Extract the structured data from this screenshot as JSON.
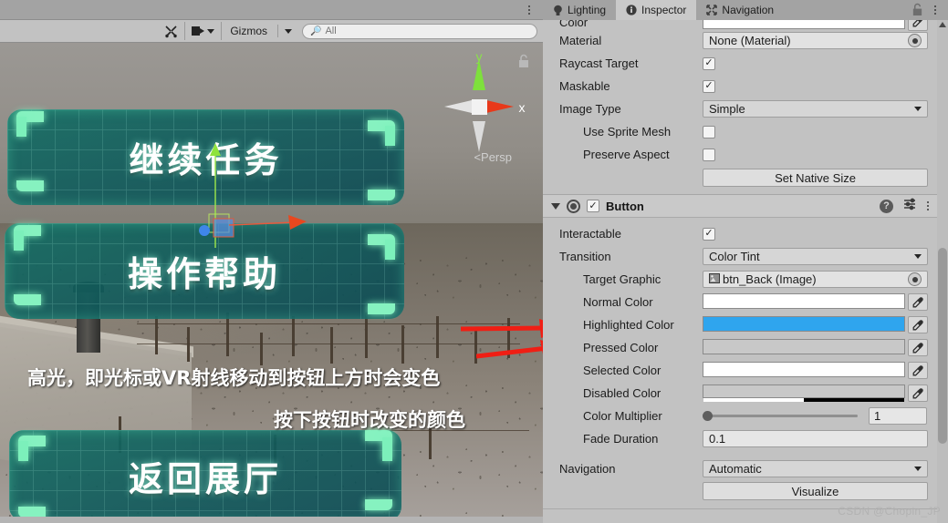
{
  "scene": {
    "toolbar": {
      "tools_icon": "tools-icon",
      "camera_icon": "camera-icon",
      "gizmos_label": "Gizmos",
      "search_placeholder": "All",
      "search_value": ""
    },
    "gizmo": {
      "axis_x": "x",
      "axis_y": "y",
      "projection": "Persp",
      "projection_prefix": "<",
      "lock_icon": "unlock-icon"
    },
    "vr_buttons": [
      {
        "label": "继续任务"
      },
      {
        "label": "操作帮助"
      },
      {
        "label": "返回展厅"
      }
    ],
    "annotations": [
      {
        "text": "高光，即光标或VR射线移动到按钮上方时会变色"
      },
      {
        "text": "按下按钮时改变的颜色"
      }
    ]
  },
  "inspector": {
    "tabs": [
      {
        "label": "Lighting",
        "icon": "lightbulb-icon",
        "active": false
      },
      {
        "label": "Inspector",
        "icon": "info-icon",
        "active": true
      },
      {
        "label": "Navigation",
        "icon": "navigation-icon",
        "active": false
      }
    ],
    "lock_icon": "lock-icon",
    "menu_icon": "kebab-menu-icon",
    "image_component": {
      "rows": [
        {
          "label": "Color",
          "type": "color",
          "value": "#FFFFFF",
          "alpha": 1
        },
        {
          "label": "Material",
          "type": "object",
          "value": "None (Material)"
        },
        {
          "label": "Raycast Target",
          "type": "checkbox",
          "value": true
        },
        {
          "label": "Maskable",
          "type": "checkbox",
          "value": true
        },
        {
          "label": "Image Type",
          "type": "popup",
          "value": "Simple"
        },
        {
          "label": "Use Sprite Mesh",
          "type": "checkbox",
          "value": false,
          "indent": true
        },
        {
          "label": "Preserve Aspect",
          "type": "checkbox",
          "value": false,
          "indent": true
        }
      ],
      "set_native_size_label": "Set Native Size"
    },
    "button_component": {
      "title": "Button",
      "enabled": true,
      "help_icon": "help-icon",
      "preset_icon": "preset-icon",
      "menu_icon": "kebab-menu-icon",
      "interactable_label": "Interactable",
      "interactable_value": true,
      "transition_label": "Transition",
      "transition_value": "Color Tint",
      "target_graphic_label": "Target Graphic",
      "target_graphic_value": "btn_Back (Image)",
      "colors": [
        {
          "label": "Normal Color",
          "value": "#FFFFFF",
          "alpha": 1
        },
        {
          "label": "Highlighted Color",
          "value": "#2FA5EE",
          "alpha": 1
        },
        {
          "label": "Pressed Color",
          "value": "#C8C8C8",
          "alpha": 1
        },
        {
          "label": "Selected Color",
          "value": "#FFFFFF",
          "alpha": 1
        },
        {
          "label": "Disabled Color",
          "value": "#C8C8C8",
          "alpha": 0.5
        }
      ],
      "color_multiplier_label": "Color Multiplier",
      "color_multiplier_value": "1",
      "fade_duration_label": "Fade Duration",
      "fade_duration_value": "0.1",
      "navigation_label": "Navigation",
      "navigation_value": "Automatic",
      "visualize_label": "Visualize"
    }
  },
  "watermark": "CSDN @Chopin_JP"
}
